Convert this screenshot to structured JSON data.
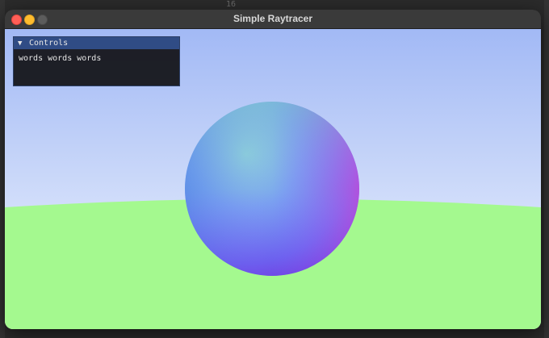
{
  "editor": {
    "line_number": "16"
  },
  "window": {
    "title": "Simple Raytracer"
  },
  "controls": {
    "header_label": "Controls",
    "body_text": "words words words",
    "arrow_icon": "triangle-down-icon"
  },
  "colors": {
    "sky_top": "#a2b9f5",
    "sky_bottom": "#e0e9fb",
    "ground": "#a4f98f",
    "panel_header": "#304c85"
  }
}
